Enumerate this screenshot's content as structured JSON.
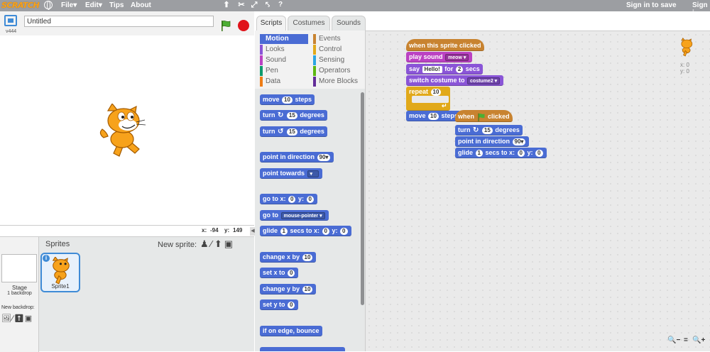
{
  "menubar": {
    "logo": "SCRATCH",
    "items": [
      "File▾",
      "Edit▾",
      "Tips",
      "About"
    ],
    "sign_in": "Sign in to save",
    "sign_in_cut": "Sign i"
  },
  "stage_header": {
    "version": "v444",
    "project_title": "Untitled"
  },
  "coords": {
    "x_label": "x:",
    "x_value": "-94",
    "y_label": "y:",
    "y_value": "149"
  },
  "sprite_pane": {
    "stage_label": "Stage",
    "backdrop_count": "1 backdrop",
    "new_backdrop": "New backdrop:",
    "sprites_title": "Sprites",
    "new_sprite": "New sprite:",
    "sprite_name": "Sprite1"
  },
  "tabs": [
    "Scripts",
    "Costumes",
    "Sounds"
  ],
  "categories": {
    "left": [
      "Motion",
      "Looks",
      "Sound",
      "Pen",
      "Data"
    ],
    "right": [
      "Events",
      "Control",
      "Sensing",
      "Operators",
      "More Blocks"
    ],
    "left_colors": [
      "#4a6cd4",
      "#8a55d7",
      "#bb42c3",
      "#0e9a6c",
      "#ee7d16"
    ],
    "right_colors": [
      "#c88330",
      "#e1a91a",
      "#2ca5e2",
      "#5cb712",
      "#632d99"
    ]
  },
  "palette": {
    "move": {
      "pre": "move",
      "val": "10",
      "post": "steps"
    },
    "turn_cw": {
      "pre": "turn",
      "val": "15",
      "post": "degrees"
    },
    "turn_ccw": {
      "pre": "turn",
      "val": "15",
      "post": "degrees"
    },
    "point_dir": {
      "pre": "point in direction",
      "val": "90▾"
    },
    "point_towards": {
      "pre": "point towards",
      "val": "▾"
    },
    "goto_xy": {
      "pre": "go to x:",
      "x": "0",
      "mid": "y:",
      "y": "0"
    },
    "goto": {
      "pre": "go to",
      "val": "mouse-pointer ▾"
    },
    "glide": {
      "pre": "glide",
      "secs": "1",
      "mid": "secs to x:",
      "x": "0",
      "ylbl": "y:",
      "y": "0"
    },
    "change_x": {
      "pre": "change x by",
      "val": "10"
    },
    "set_x": {
      "pre": "set x to",
      "val": "0"
    },
    "change_y": {
      "pre": "change y by",
      "val": "10"
    },
    "set_y": {
      "pre": "set y to",
      "val": "0"
    },
    "bounce": {
      "pre": "if on edge, bounce"
    }
  },
  "script": {
    "when_clicked": "when this sprite clicked",
    "play_sound": {
      "pre": "play sound",
      "val": "meow ▾"
    },
    "say": {
      "pre": "say",
      "msg": "Hello!",
      "mid": "for",
      "secs": "2",
      "post": "secs"
    },
    "switch_costume": {
      "pre": "switch costume to",
      "val": "costume2 ▾"
    },
    "repeat": {
      "pre": "repeat",
      "val": "10"
    },
    "move": {
      "pre": "move",
      "val": "10",
      "post": "steps"
    },
    "when_flag": {
      "pre": "when",
      "post": "clicked"
    },
    "turn": {
      "pre": "turn",
      "val": "15",
      "post": "degrees"
    },
    "point": {
      "pre": "point in direction",
      "val": "90▾"
    },
    "glide": {
      "pre": "glide",
      "secs": "1",
      "mid": "secs to x:",
      "x": "0",
      "ylbl": "y:",
      "y": "0"
    }
  },
  "sprite_info": {
    "x": "x: 0",
    "y": "y: 0"
  },
  "zoom": [
    "−",
    "=",
    "+"
  ]
}
